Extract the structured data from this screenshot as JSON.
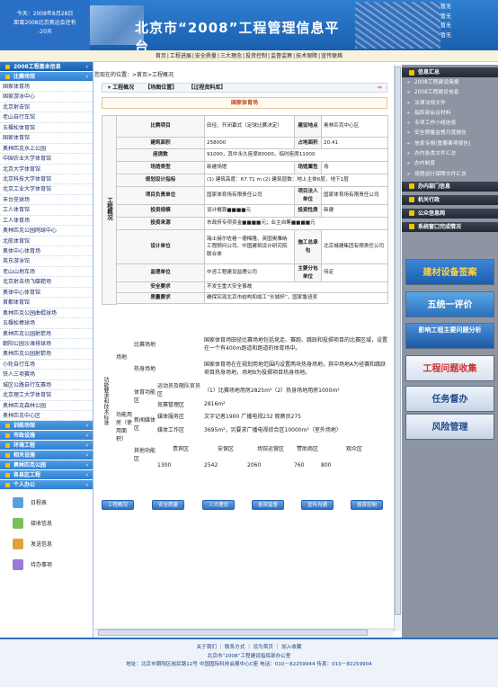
{
  "banner": {
    "left_lines": [
      "今天：2008年8月28日",
      "距离2008北京奥运会还有",
      "-20天"
    ],
    "title": "北京市“2008”工程管理信息平台",
    "right_lines": [
      "暂无",
      "暂无",
      "暂无",
      "暂无"
    ]
  },
  "nav": [
    "首页",
    "工程进展",
    "安全质量",
    "三大理念",
    "投资控制",
    "监督监察",
    "技术保障",
    "宣传联络"
  ],
  "left": {
    "head1": "2008工程基本信息",
    "head2": "比赛场馆",
    "venues": [
      "国家体育场",
      "国家游泳中心",
      "北京射击馆",
      "老山自行车馆",
      "五棵松体育馆",
      "国家体育馆",
      "奥林匹克水上公园",
      "中国农业大学体育馆",
      "北京大学体育馆",
      "北京科技大学体育馆",
      "北京工业大学体育馆",
      "丰台垒球场",
      "工人体育馆",
      "工人体育场",
      "奥林匹克公园网球中心",
      "北航体育馆",
      "奥体中心体育场",
      "英东游泳馆",
      "老山山地车场",
      "北京射击场飞碟靶场",
      "奥体中心体育馆",
      "首都体育馆",
      "奥林匹克公园曲棍球场",
      "五棵松棒球场",
      "奥林匹克公园射箭场",
      "朝阳公园沙滩排球场",
      "奥林匹克公园射箭场",
      "小轮自行车场",
      "铁人三项赛场",
      "城区公路自行车赛场",
      "北京理工大学体育馆",
      "奥林匹克森林公园",
      "奥林匹克中心区"
    ],
    "groups": [
      "训练场馆",
      "市政设施",
      "环境工程",
      "相关设施",
      "奥林匹克公园",
      "各县区工程",
      "个人办公"
    ],
    "tools": [
      "日程表",
      "接收信息",
      "发送信息",
      "待办事项"
    ]
  },
  "content": {
    "crumb": "您现在的位置：>首页>工程概况",
    "tabs": [
      "工程概况",
      "【场图位置】",
      "【过程资料库】"
    ],
    "page_title": "国家体育场",
    "rows": {
      "name_label": "比赛项目",
      "name_value": "田径、开闭幕式（足球比赛决定）",
      "loc_label": "建设地点",
      "loc_value": "奥林匹克中心区",
      "area_label": "建筑面积",
      "area_value": "258000",
      "land_label": "占地面积",
      "land_value": "20.41",
      "seat_label": "座席数",
      "seat_value": "91000，其中永久座席80000，临时座席11000",
      "type_label": "场馆类型",
      "type_value": "新建场馆",
      "prop_label": "场馆属性",
      "prop_value": "场",
      "design_label": "规划设计指标",
      "design_value": "(1) 建筑高度：67.71 m (2) 建筑层数：地上主体6层，地下1层",
      "owner_label": "项目负责单位",
      "owner_value": "国家体育场有限责任公司",
      "law_label": "项目法人单位",
      "law_value": "国家体育场有限责任公司",
      "scale_label": "投资规模",
      "scale_value": "设计概算■■■■元",
      "invtype_label": "投资性质",
      "invtype_value": "新建",
      "src_label": "投资来源",
      "src_value": "市政府专项资金■■■■元；业主自筹■■■■元",
      "des_label": "设计单位",
      "des_value": "瑞士赫尔佐格－德梅隆、英国奥雅纳工程顾问公司、中国建筑设计研究院联合体",
      "con_label": "施工总承包",
      "con_value": "北京城建集团有限责任公司",
      "sup_label": "监理单位",
      "sup_value": "中咨工程建设监理公司",
      "sub_label": "主要分包单位",
      "sub_value": "待定",
      "safe_label": "安全要求",
      "safe_value": "不发生重大安全事故",
      "qual_label": "质量要求",
      "qual_value": "确保实现北京市结构和竣工“长城杯”，国家鲁班奖"
    },
    "sec1": "工程概况",
    "sec2": "功能要求和技术标准",
    "venue_label": "场地",
    "comp_label": "比赛场地",
    "comp_value": "国家体育场田径比赛场地包括竞走、赛跑、跳跃和投掷项目的比赛区域，设置在一个有400m跑道和跑道的体育场中。",
    "warm_label": "热身场地",
    "warm_value": "国家体育场在在规划用地范围内设置两块热身场地，其中场地A为径赛和跳跃项目热身场地，场地B为投掷项目热身场地。",
    "func_label": "功能用房（使用面积）",
    "sport_label": "体育功能区",
    "sport_a_label": "运动员及随队官员区",
    "sport_a_value": "（1）比赛场地用房2825m²（2）热身场地用房1000m²",
    "sport_b_label": "竞赛管理区",
    "sport_b_value": "2816m²",
    "media_label": "新闻媒体区",
    "media_a_label": "媒体服务区",
    "media_a_value": "文字记者1900 广播电视232 观察员275",
    "media_b_label": "媒体工作区",
    "media_b_value": "3695m²，另要求广播电视综合区10000m²（室外场地）",
    "other_label": "其他功能区",
    "other_heads": [
      "贵宾区",
      "安保区",
      "场馆运营区",
      "赞助商区",
      "观众区"
    ],
    "other_values": [
      "1300",
      "2542",
      "2060",
      "760",
      "800"
    ],
    "buttons": [
      "工程概况",
      "安全质量",
      "三大理念",
      "投资监督",
      "宣传沟通",
      "投资控制"
    ]
  },
  "right": {
    "head1": "信息汇总",
    "items1": [
      "2008工程建设简报",
      "2008工程建设信息",
      "法律法规文件",
      "指挥部会议材料",
      "专项工作小组信息",
      "安全质量监督月度报告",
      "信息专报(重要事项报告)",
      "办内各类文件汇总",
      "办内制度",
      "场馆运行保障文件汇总"
    ],
    "head2": "办内部门信息",
    "head3": "机关行政",
    "head4": "公众信息网",
    "head5": "系统窗口完成情况",
    "promos": [
      "建材设备签案",
      "五统一评价",
      "影响工程主要问题分析",
      "工程问题收集",
      "任务督办",
      "风险管理"
    ]
  },
  "footer": {
    "line1": "关于我们 ｜ 联系方式 ｜ 设为首页 ｜ 加入收藏",
    "line2": "北京市“2008”工程建设指挥部办公室",
    "line3": "地址：北京市朝阳区裕民路12号 中国国际科技会展中心C座  电话：010－82259944  传真：010－82259904"
  }
}
